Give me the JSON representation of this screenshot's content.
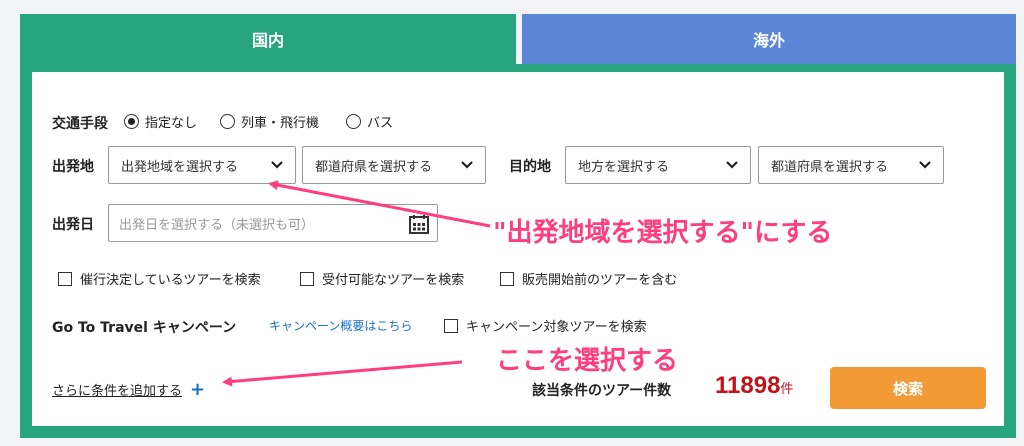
{
  "tabs": {
    "domestic": "国内",
    "overseas": "海外"
  },
  "transport": {
    "label": "交通手段",
    "options": [
      "指定なし",
      "列車・飛行機",
      "バス"
    ],
    "selected_index": 0
  },
  "departure": {
    "label": "出発地",
    "region_select": "出発地域を選択する",
    "prefecture_select": "都道府県を選択する"
  },
  "destination": {
    "label": "目的地",
    "region_select": "地方を選択する",
    "prefecture_select": "都道府県を選択する"
  },
  "departure_date": {
    "label": "出発日",
    "placeholder": "出発日を選択する（未選択も可）"
  },
  "filters": [
    "催行決定しているツアーを検索",
    "受付可能なツアーを検索",
    "販売開始前のツアーを含む"
  ],
  "campaign": {
    "title": "Go To Travel キャンペーン",
    "overview_link": "キャンペーン概要はこちら",
    "checkbox": "キャンペーン対象ツアーを検索"
  },
  "more_conditions": {
    "label": "さらに条件を追加する",
    "icon": "+"
  },
  "result": {
    "label": "該当条件のツアー件数",
    "count": "11898",
    "unit": "件",
    "search_button": "検索"
  },
  "annotations": {
    "select_region": "\"出発地域を選択する\"にする",
    "select_here": "ここを選択する"
  },
  "colors": {
    "domestic_tab": "#27a57e",
    "overseas_tab": "#5b86d6",
    "search_button": "#f19a36",
    "count": "#c0131a",
    "annotation": "#ff3d7f",
    "link": "#1a6fc4"
  }
}
